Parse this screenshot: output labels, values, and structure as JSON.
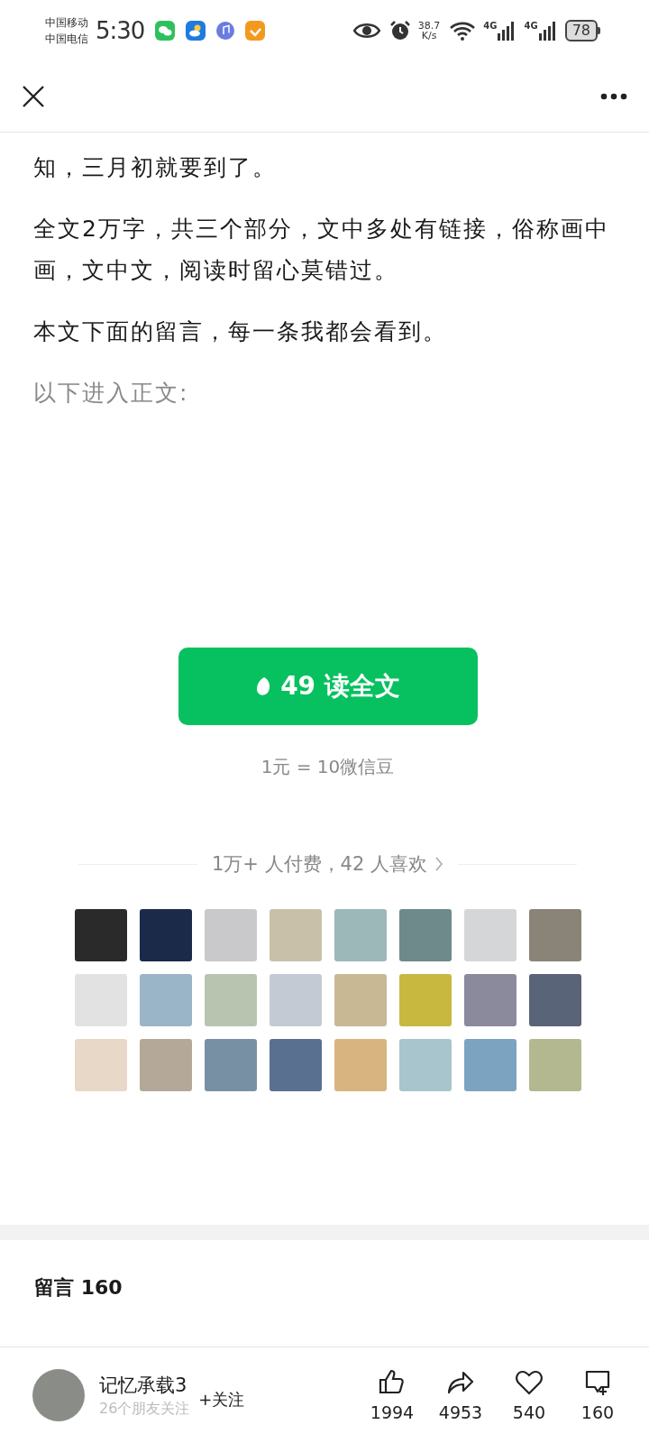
{
  "status_bar": {
    "carriers": [
      "中国移动",
      "中国电信"
    ],
    "time": "5:30",
    "net_speed": [
      "38.7",
      "K/s"
    ],
    "signals": [
      "4G",
      "4G"
    ],
    "battery": "78"
  },
  "article": {
    "paragraphs": [
      {
        "text": "知，三月初就要到了。",
        "muted": false
      },
      {
        "text": "全文2万字，共三个部分，文中多处有链接，俗称画中画，文中文，阅读时留心莫错过。",
        "muted": false
      },
      {
        "text": "本文下面的留言，每一条我都会看到。",
        "muted": false
      },
      {
        "text": "以下进入正文:",
        "muted": true
      }
    ]
  },
  "paywall": {
    "button": "49 读全文",
    "rate": "1元 = 10微信豆",
    "supporters": "1万+ 人付费，42 人喜欢",
    "avatars": [
      {
        "color": "#2a2a2a"
      },
      {
        "color": "#1c2a4a"
      },
      {
        "color": "#c9c9cc"
      },
      {
        "color": "#c8c0a8"
      },
      {
        "color": "#9cb8b8"
      },
      {
        "color": "#6e8a8a"
      },
      {
        "color": "#d4d6d8"
      },
      {
        "color": "#8a8478"
      },
      {
        "color": "#e2e2e2"
      },
      {
        "color": "#9ab4c8"
      },
      {
        "color": "#b8c4b0"
      },
      {
        "color": "#c4cad4"
      },
      {
        "color": "#c8b894"
      },
      {
        "color": "#c8b840"
      },
      {
        "color": "#8a8a9c"
      },
      {
        "color": "#5a6478"
      },
      {
        "color": "#e8d8c8"
      },
      {
        "color": "#b4a898"
      },
      {
        "color": "#7890a4"
      },
      {
        "color": "#5a7090"
      },
      {
        "color": "#d8b480"
      },
      {
        "color": "#a8c4cc"
      },
      {
        "color": "#7ca4c0"
      },
      {
        "color": "#b4b890"
      }
    ]
  },
  "comments": {
    "title": "留言 160"
  },
  "footer": {
    "author": "记忆承载3",
    "followers": "26个朋友关注",
    "follow": "+关注",
    "stats": [
      {
        "kind": "like",
        "count": "1994"
      },
      {
        "kind": "share",
        "count": "4953"
      },
      {
        "kind": "heart",
        "count": "540"
      },
      {
        "kind": "comment",
        "count": "160"
      }
    ]
  }
}
